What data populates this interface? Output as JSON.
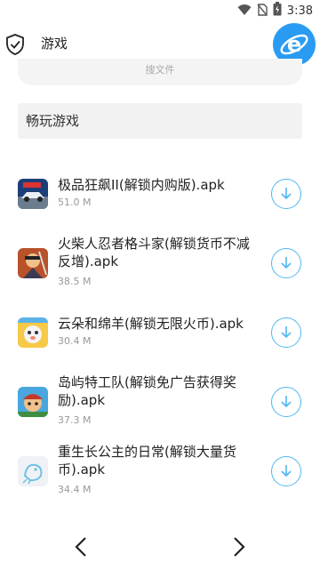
{
  "status": {
    "time": "3:38"
  },
  "header": {
    "title": "游戏"
  },
  "search": {
    "placeholder": "搜文件"
  },
  "category": {
    "label": "畅玩游戏"
  },
  "files": [
    {
      "name": "极品狂飙II(解锁内购版).apk",
      "size": "51.0 M",
      "icon": "racing-car-game-icon"
    },
    {
      "name": "火柴人忍者格斗家(解锁货币不减反增).apk",
      "size": "38.5 M",
      "icon": "ninja-game-icon"
    },
    {
      "name": "云朵和绵羊(解锁无限火币).apk",
      "size": "30.4 M",
      "icon": "cloud-sheep-game-icon"
    },
    {
      "name": "岛屿特工队(解锁免广告获得奖励).apk",
      "size": "37.3 M",
      "icon": "island-agent-game-icon"
    },
    {
      "name": "重生长公主的日常(解锁大量货币).apk",
      "size": "34.4 M",
      "icon": "princess-game-icon"
    }
  ],
  "colors": {
    "accent": "#4fb7f0",
    "browser": "#2a9bf2"
  }
}
